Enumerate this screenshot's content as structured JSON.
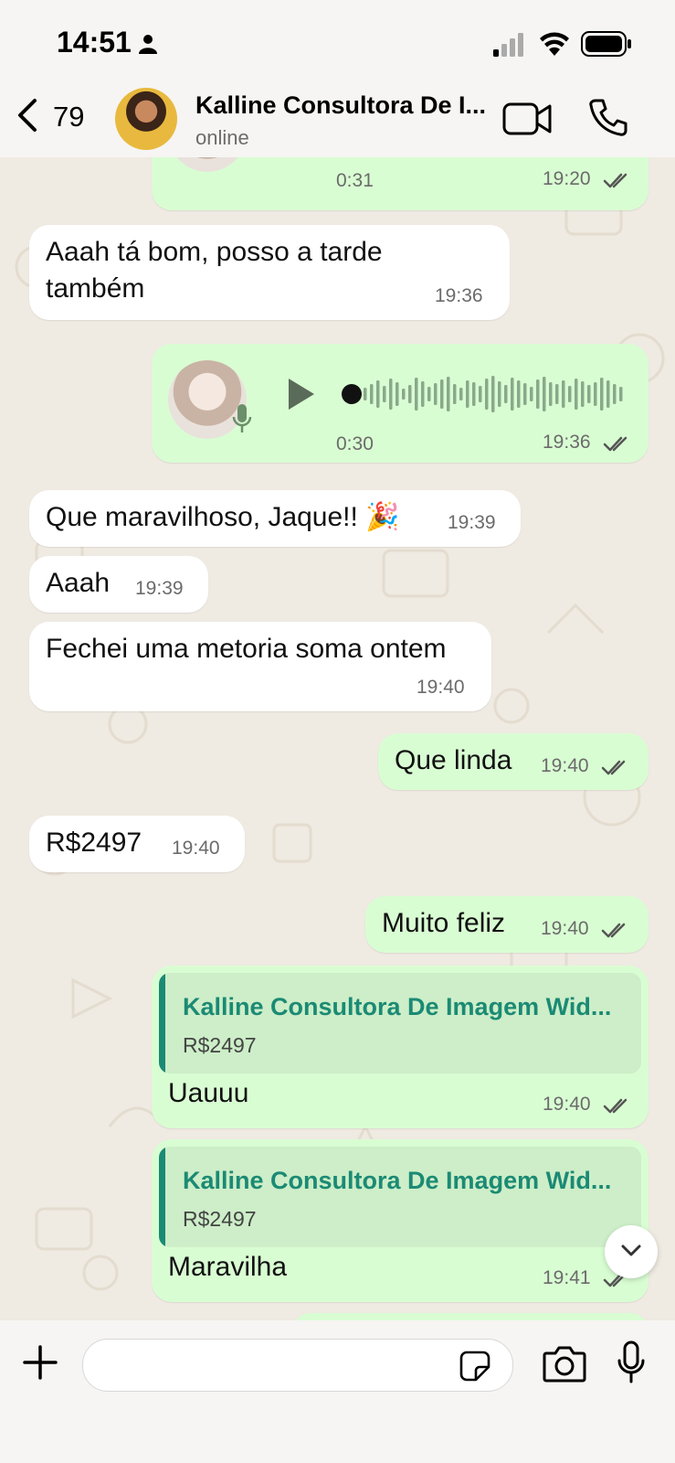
{
  "status_bar": {
    "time": "14:51"
  },
  "header": {
    "back_count": "79",
    "contact_name": "Kalline Consultora De I...",
    "contact_status": "online"
  },
  "messages": [
    {
      "dir": "out",
      "type": "audio",
      "duration": "0:31",
      "time": "19:20"
    },
    {
      "dir": "in",
      "text_line1": "Aaah tá bom, posso a tarde",
      "text_line2": "também",
      "time": "19:36"
    },
    {
      "dir": "out",
      "type": "audio",
      "duration": "0:30",
      "time": "19:36"
    },
    {
      "dir": "in",
      "text": "Que maravilhoso, Jaque!! 🎉",
      "time": "19:39"
    },
    {
      "dir": "in",
      "text": "Aaah",
      "time": "19:39"
    },
    {
      "dir": "in",
      "text": "Fechei uma metoria soma ontem",
      "time": "19:40"
    },
    {
      "dir": "out",
      "text": "Que linda",
      "time": "19:40"
    },
    {
      "dir": "in",
      "text": "R$2497",
      "time": "19:40"
    },
    {
      "dir": "out",
      "text": "Muito feliz",
      "time": "19:40"
    },
    {
      "dir": "out",
      "quote_name": "Kalline Consultora De Imagem Wid...",
      "quote_text": "R$2497",
      "text": "Uauuu",
      "time": "19:40"
    },
    {
      "dir": "out",
      "quote_name": "Kalline Consultora De Imagem Wid...",
      "quote_text": "R$2497",
      "text": "Maravilha",
      "time": "19:41"
    }
  ],
  "colors": {
    "accent": "#1b8a74",
    "outgoing_bubble": "#d9fdd3",
    "incoming_bubble": "#ffffff",
    "read_ticks": "#53bdeb"
  },
  "icons": [
    "person-icon",
    "signal-icon",
    "wifi-icon",
    "battery-icon",
    "back-chevron-icon",
    "video-call-icon",
    "phone-icon",
    "play-icon",
    "mic-icon",
    "double-check-icon",
    "scroll-down-icon",
    "plus-icon",
    "sticker-icon",
    "camera-icon"
  ]
}
